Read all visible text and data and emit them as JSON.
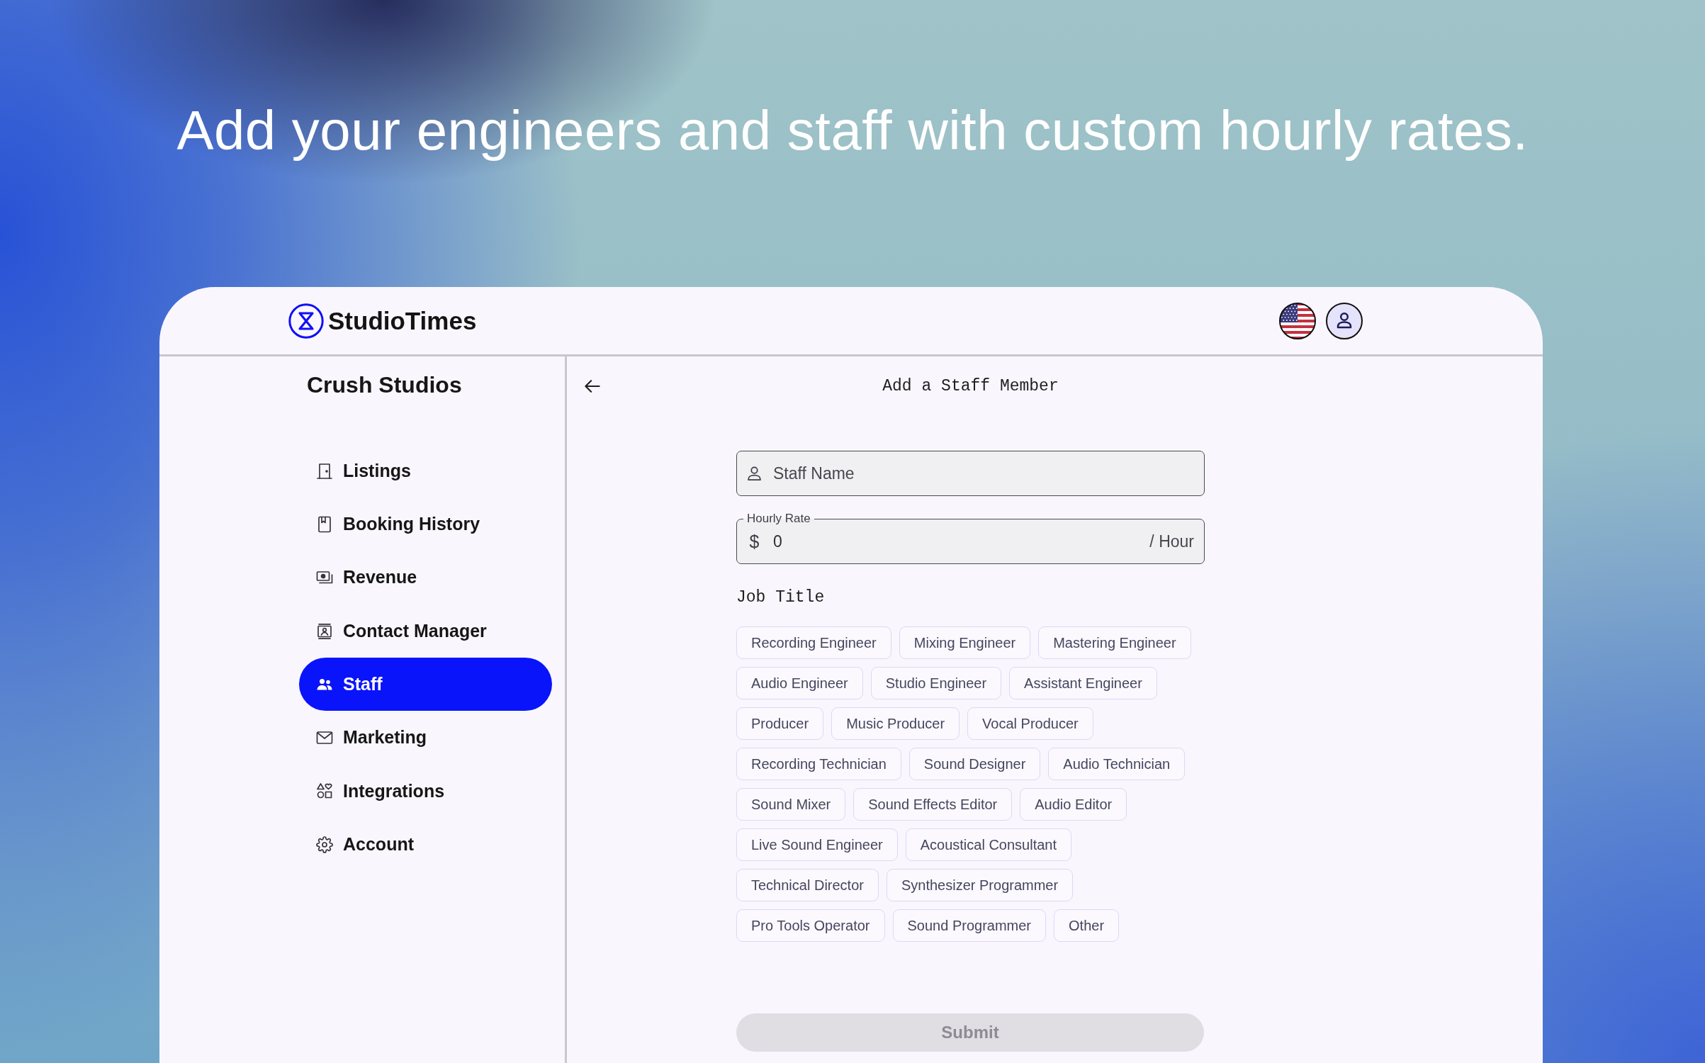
{
  "headline": "Add your engineers and staff with custom hourly rates.",
  "header": {
    "brand": "StudioTimes"
  },
  "sidebar": {
    "title": "Crush Studios",
    "items": [
      {
        "label": "Listings",
        "selected": false
      },
      {
        "label": "Booking History",
        "selected": false
      },
      {
        "label": "Revenue",
        "selected": false
      },
      {
        "label": "Contact Manager",
        "selected": false
      },
      {
        "label": "Staff",
        "selected": true
      },
      {
        "label": "Marketing",
        "selected": false
      },
      {
        "label": "Integrations",
        "selected": false
      },
      {
        "label": "Account",
        "selected": false
      }
    ]
  },
  "form": {
    "title": "Add a Staff Member",
    "staff_name": {
      "placeholder": "Staff Name"
    },
    "hourly_rate": {
      "label": "Hourly Rate",
      "prefix": "$",
      "value": "0",
      "suffix": "/ Hour"
    },
    "job_title": {
      "label": "Job Title",
      "options": [
        {
          "label": "Recording Engineer",
          "selected": false
        },
        {
          "label": "Mixing Engineer",
          "selected": false
        },
        {
          "label": "Mastering Engineer",
          "selected": false
        },
        {
          "label": "Audio Engineer",
          "selected": false
        },
        {
          "label": "Studio Engineer",
          "selected": false
        },
        {
          "label": "Assistant Engineer",
          "selected": false
        },
        {
          "label": "Producer",
          "selected": false
        },
        {
          "label": "Music Producer",
          "selected": false
        },
        {
          "label": "Vocal Producer",
          "selected": false
        },
        {
          "label": "Recording Technician",
          "selected": false
        },
        {
          "label": "Sound Designer",
          "selected": false
        },
        {
          "label": "Audio Technician",
          "selected": false
        },
        {
          "label": "Sound Mixer",
          "selected": false
        },
        {
          "label": "Sound Effects Editor",
          "selected": false
        },
        {
          "label": "Audio Editor",
          "selected": false
        },
        {
          "label": "Live Sound Engineer",
          "selected": false
        },
        {
          "label": "Acoustical Consultant",
          "selected": false
        },
        {
          "label": "Technical Director",
          "selected": false
        },
        {
          "label": "Synthesizer Programmer",
          "selected": false
        },
        {
          "label": "Pro Tools Operator",
          "selected": false
        },
        {
          "label": "Sound Programmer",
          "selected": false
        },
        {
          "label": "Other",
          "selected": false
        }
      ]
    },
    "submit": {
      "label": "Submit",
      "disabled": true
    }
  }
}
